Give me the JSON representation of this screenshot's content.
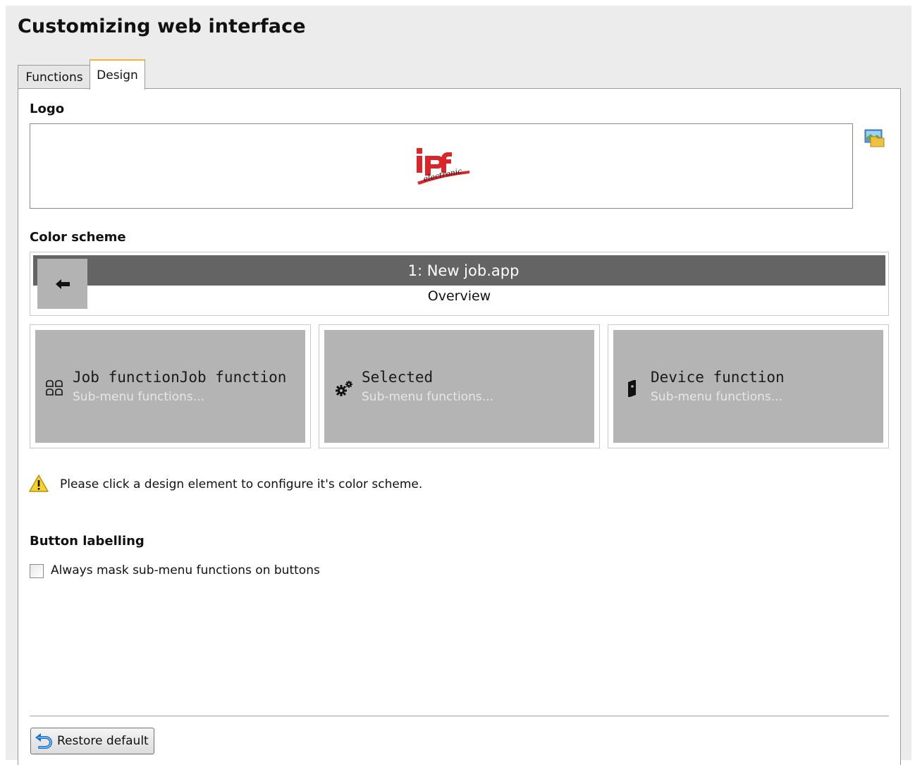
{
  "page": {
    "title": "Customizing web interface"
  },
  "tabs": [
    {
      "label": "Functions",
      "active": false
    },
    {
      "label": "Design",
      "active": true
    }
  ],
  "logo": {
    "label": "Logo",
    "browse_icon": "image-folder-icon",
    "logo_icon": "ipf-electronic-logo"
  },
  "color_scheme": {
    "label": "Color scheme",
    "app_bar_title": "1: New job.app",
    "back_icon": "arrow-left-icon",
    "breadcrumb": "Overview",
    "tiles": [
      {
        "icon": "grid-icon",
        "title": "Job functionJob function",
        "subtitle": "Sub-menu functions..."
      },
      {
        "icon": "gears-icon",
        "title": "Selected",
        "subtitle": "Sub-menu functions..."
      },
      {
        "icon": "device-icon",
        "title": "Device function",
        "subtitle": "Sub-menu functions..."
      }
    ],
    "colors": {
      "app_bar": "#646464",
      "tile": "#b4b4b4",
      "back_button": "#b3b3b3"
    }
  },
  "hint": {
    "icon": "warning-icon",
    "text": "Please click a design element to configure it's color scheme."
  },
  "button_labelling": {
    "label": "Button labelling",
    "checkbox_label": "Always mask sub-menu functions on buttons",
    "checked": false
  },
  "footer": {
    "restore_label": "Restore default",
    "restore_icon": "undo-icon"
  }
}
